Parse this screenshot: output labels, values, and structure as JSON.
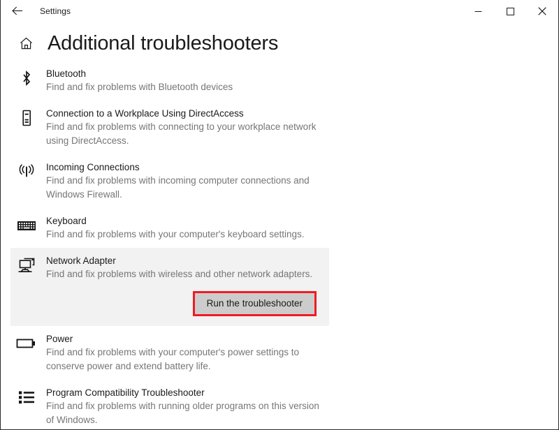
{
  "window": {
    "app_title": "Settings",
    "back_icon": "back-arrow-icon",
    "minimize_label": "—",
    "maximize_label": "□",
    "close_label": "✕"
  },
  "header": {
    "home_icon": "home-icon",
    "title": "Additional troubleshooters"
  },
  "colors": {
    "accent_annotation": "#ee1c24",
    "selected_background": "#f2f2f2",
    "button_background": "#cccccc",
    "text_primary": "#1a1a1a",
    "text_secondary": "#767676"
  },
  "troubleshooters": [
    {
      "icon": "bluetooth-icon",
      "name": "Bluetooth",
      "description": "Find and fix problems with Bluetooth devices",
      "selected": false
    },
    {
      "icon": "directaccess-device-icon",
      "name": "Connection to a Workplace Using DirectAccess",
      "description": "Find and fix problems with connecting to your workplace network using DirectAccess.",
      "selected": false
    },
    {
      "icon": "incoming-connections-antenna-icon",
      "name": "Incoming Connections",
      "description": "Find and fix problems with incoming computer connections and Windows Firewall.",
      "selected": false
    },
    {
      "icon": "keyboard-icon",
      "name": "Keyboard",
      "description": "Find and fix problems with your computer's keyboard settings.",
      "selected": false
    },
    {
      "icon": "network-adapter-icon",
      "name": "Network Adapter",
      "description": "Find and fix problems with wireless and other network adapters.",
      "selected": true,
      "action_label": "Run the troubleshooter"
    },
    {
      "icon": "battery-power-icon",
      "name": "Power",
      "description": "Find and fix problems with your computer's power settings to conserve power and extend battery life.",
      "selected": false
    },
    {
      "icon": "program-compatibility-list-icon",
      "name": "Program Compatibility Troubleshooter",
      "description": "Find and fix problems with running older programs on this version of Windows.",
      "selected": false
    }
  ]
}
